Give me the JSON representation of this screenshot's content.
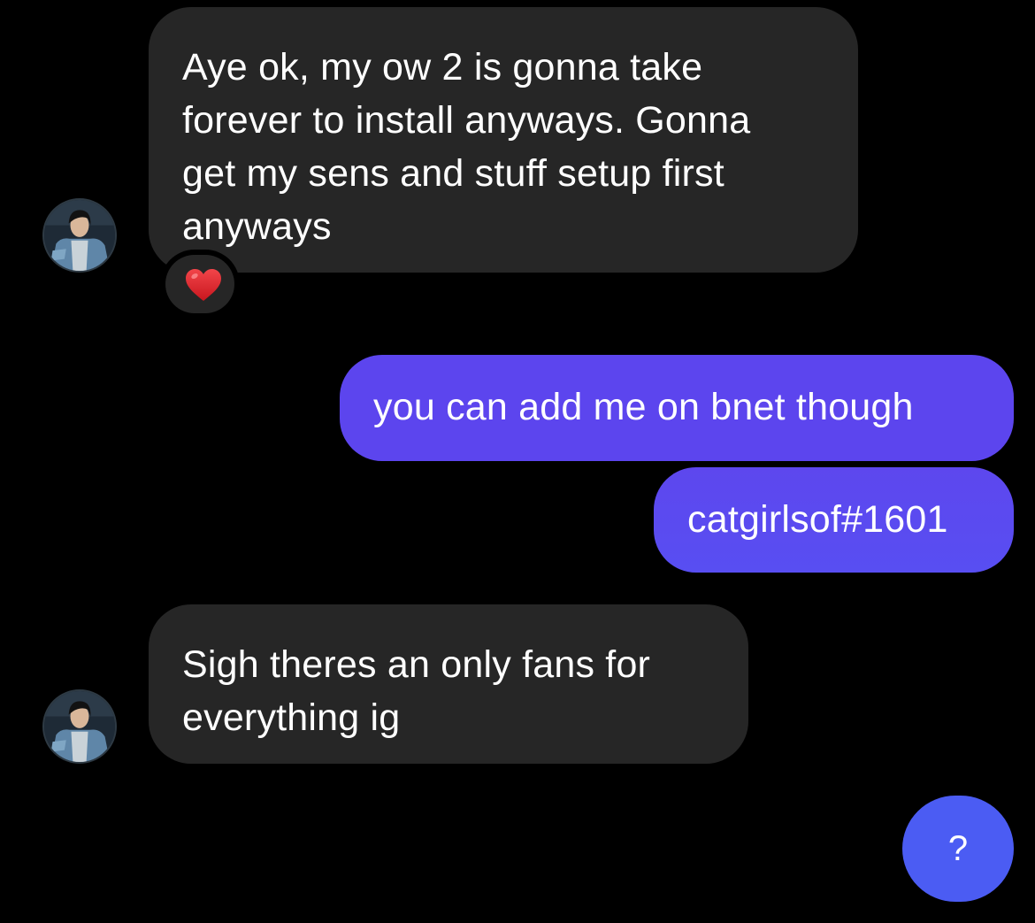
{
  "conversation": {
    "messages": [
      {
        "direction": "incoming",
        "lines": [
          "Aye ok, my ow 2 is gonna take",
          "forever to install anyways. Gonna",
          "get my sens and stuff setup first",
          "anyways"
        ],
        "reaction": "heart-emoji"
      },
      {
        "direction": "outgoing",
        "lines": [
          "you can add me on bnet though"
        ]
      },
      {
        "direction": "outgoing",
        "lines": [
          "catgirlsof#1601"
        ]
      },
      {
        "direction": "incoming",
        "lines": [
          "Sigh theres an only fans for",
          "everything ig"
        ]
      }
    ]
  },
  "fab": {
    "label": "?",
    "icon": "question-mark"
  },
  "colors": {
    "background": "#000000",
    "incoming_bubble": "#262626",
    "outgoing_bubble": "#5c45ee",
    "fab": "#4b5cf3",
    "reaction_heart": "#e0242b"
  }
}
